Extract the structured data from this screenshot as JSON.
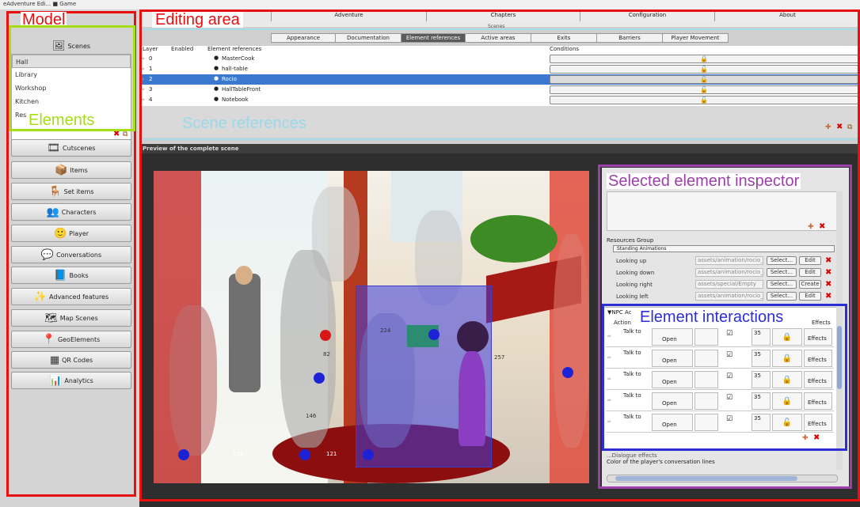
{
  "window": {
    "title": "eAdventure Edi... ■ Game"
  },
  "menu": {
    "items": [
      "Adventure",
      "Chapters",
      "Configuration",
      "About"
    ],
    "sub_label": "Scenes"
  },
  "tabs": [
    "Appearance",
    "Documentation",
    "Element references",
    "Active areas",
    "Exits",
    "Barriers",
    "Player Movement"
  ],
  "table": {
    "headers": {
      "layer": "Layer",
      "enabled": "Enabled",
      "element": "Element references",
      "conditions": "Conditions"
    },
    "rows": [
      {
        "layer": "0",
        "element": "MasterCook",
        "icon": "character-icon",
        "lock": "🔒"
      },
      {
        "layer": "1",
        "element": "hall-table",
        "icon": "set-item-icon",
        "lock": "🔓"
      },
      {
        "layer": "2",
        "element": "Rocio",
        "icon": "character-icon",
        "lock": "🔓"
      },
      {
        "layer": "3",
        "element": "HallTableFront",
        "icon": "set-item-icon",
        "lock": "🔓"
      },
      {
        "layer": "4",
        "element": "Notebook",
        "icon": "item-icon",
        "lock": "🔓"
      }
    ]
  },
  "sidebar": {
    "scenes_label": "Scenes",
    "scenes": [
      "Hall",
      "Library",
      "Workshop",
      "Kitchen",
      "Res"
    ],
    "buttons": [
      {
        "label": "Cutscenes",
        "icon": "film-icon",
        "glyph": "🎞"
      },
      {
        "label": "Items",
        "icon": "items-icon",
        "glyph": "📦"
      },
      {
        "label": "Set items",
        "icon": "set-items-icon",
        "glyph": "🪑"
      },
      {
        "label": "Characters",
        "icon": "characters-icon",
        "glyph": "👥"
      },
      {
        "label": "Player",
        "icon": "player-icon",
        "glyph": "🙂"
      },
      {
        "label": "Conversations",
        "icon": "conversations-icon",
        "glyph": "💬"
      },
      {
        "label": "Books",
        "icon": "book-icon",
        "glyph": "📘"
      },
      {
        "label": "Advanced features",
        "icon": "advanced-icon",
        "glyph": "✨"
      },
      {
        "label": "Map Scenes",
        "icon": "map-icon",
        "glyph": "🗺"
      },
      {
        "label": "GeoElements",
        "icon": "geo-pin-icon",
        "glyph": "📍"
      },
      {
        "label": "QR Codes",
        "icon": "qr-icon",
        "glyph": "▦"
      },
      {
        "label": "Analytics",
        "icon": "analytics-icon",
        "glyph": "📊"
      }
    ]
  },
  "preview": {
    "title": "Preview of the complete scene",
    "labels": {
      "d1": "255",
      "d2": "121",
      "d3": "257",
      "d4": "82",
      "d5": "146",
      "d6": "224"
    }
  },
  "inspector": {
    "resources_group": "Resources Group",
    "standing_animations": "Standing Animations",
    "rows": [
      {
        "label": "Looking up",
        "path": "assets/animation/rocio_",
        "b1": "Select...",
        "b2": "Edit"
      },
      {
        "label": "Looking down",
        "path": "assets/animation/rocio_",
        "b1": "Select...",
        "b2": "Edit"
      },
      {
        "label": "Looking right",
        "path": "assets/special/Empty",
        "b1": "Select...",
        "b2": "Create"
      },
      {
        "label": "Looking left",
        "path": "assets/animation/rocio_",
        "b1": "Select...",
        "b2": "Edit"
      }
    ],
    "npc_header": "▼NPC Ac",
    "action_header": "Action",
    "effects_header": "Effects",
    "actions": [
      {
        "action": "Talk to",
        "btn": "Open",
        "num": "35",
        "lock": "🔒",
        "effects": "Effects"
      },
      {
        "action": "Talk to",
        "btn": "Open",
        "num": "35",
        "lock": "🔒",
        "effects": "Effects"
      },
      {
        "action": "Talk to",
        "btn": "Open",
        "num": "35",
        "lock": "🔒",
        "effects": "Effects"
      },
      {
        "action": "Talk to",
        "btn": "Open",
        "num": "35",
        "lock": "🔒",
        "effects": "Effects"
      },
      {
        "action": "Talk to",
        "btn": "Open",
        "num": "35",
        "lock": "🔓",
        "effects": "Effects"
      }
    ],
    "color_label": "Color of the player's conversation lines",
    "obscured_label": "...Dialogue effects"
  },
  "annotations": {
    "model": "Model",
    "editing_area": "Editing area",
    "elements": "Elements",
    "scene_references": "Scene references",
    "selected_inspector": "Selected element inspector",
    "element_interactions": "Element interactions"
  },
  "colors": {
    "red": "#e81010",
    "lime": "#a7dd17",
    "cyan": "#9ad8ea",
    "purple": "#9d3fa9",
    "blue": "#2d2fd6",
    "selection": "#3b79d0"
  }
}
